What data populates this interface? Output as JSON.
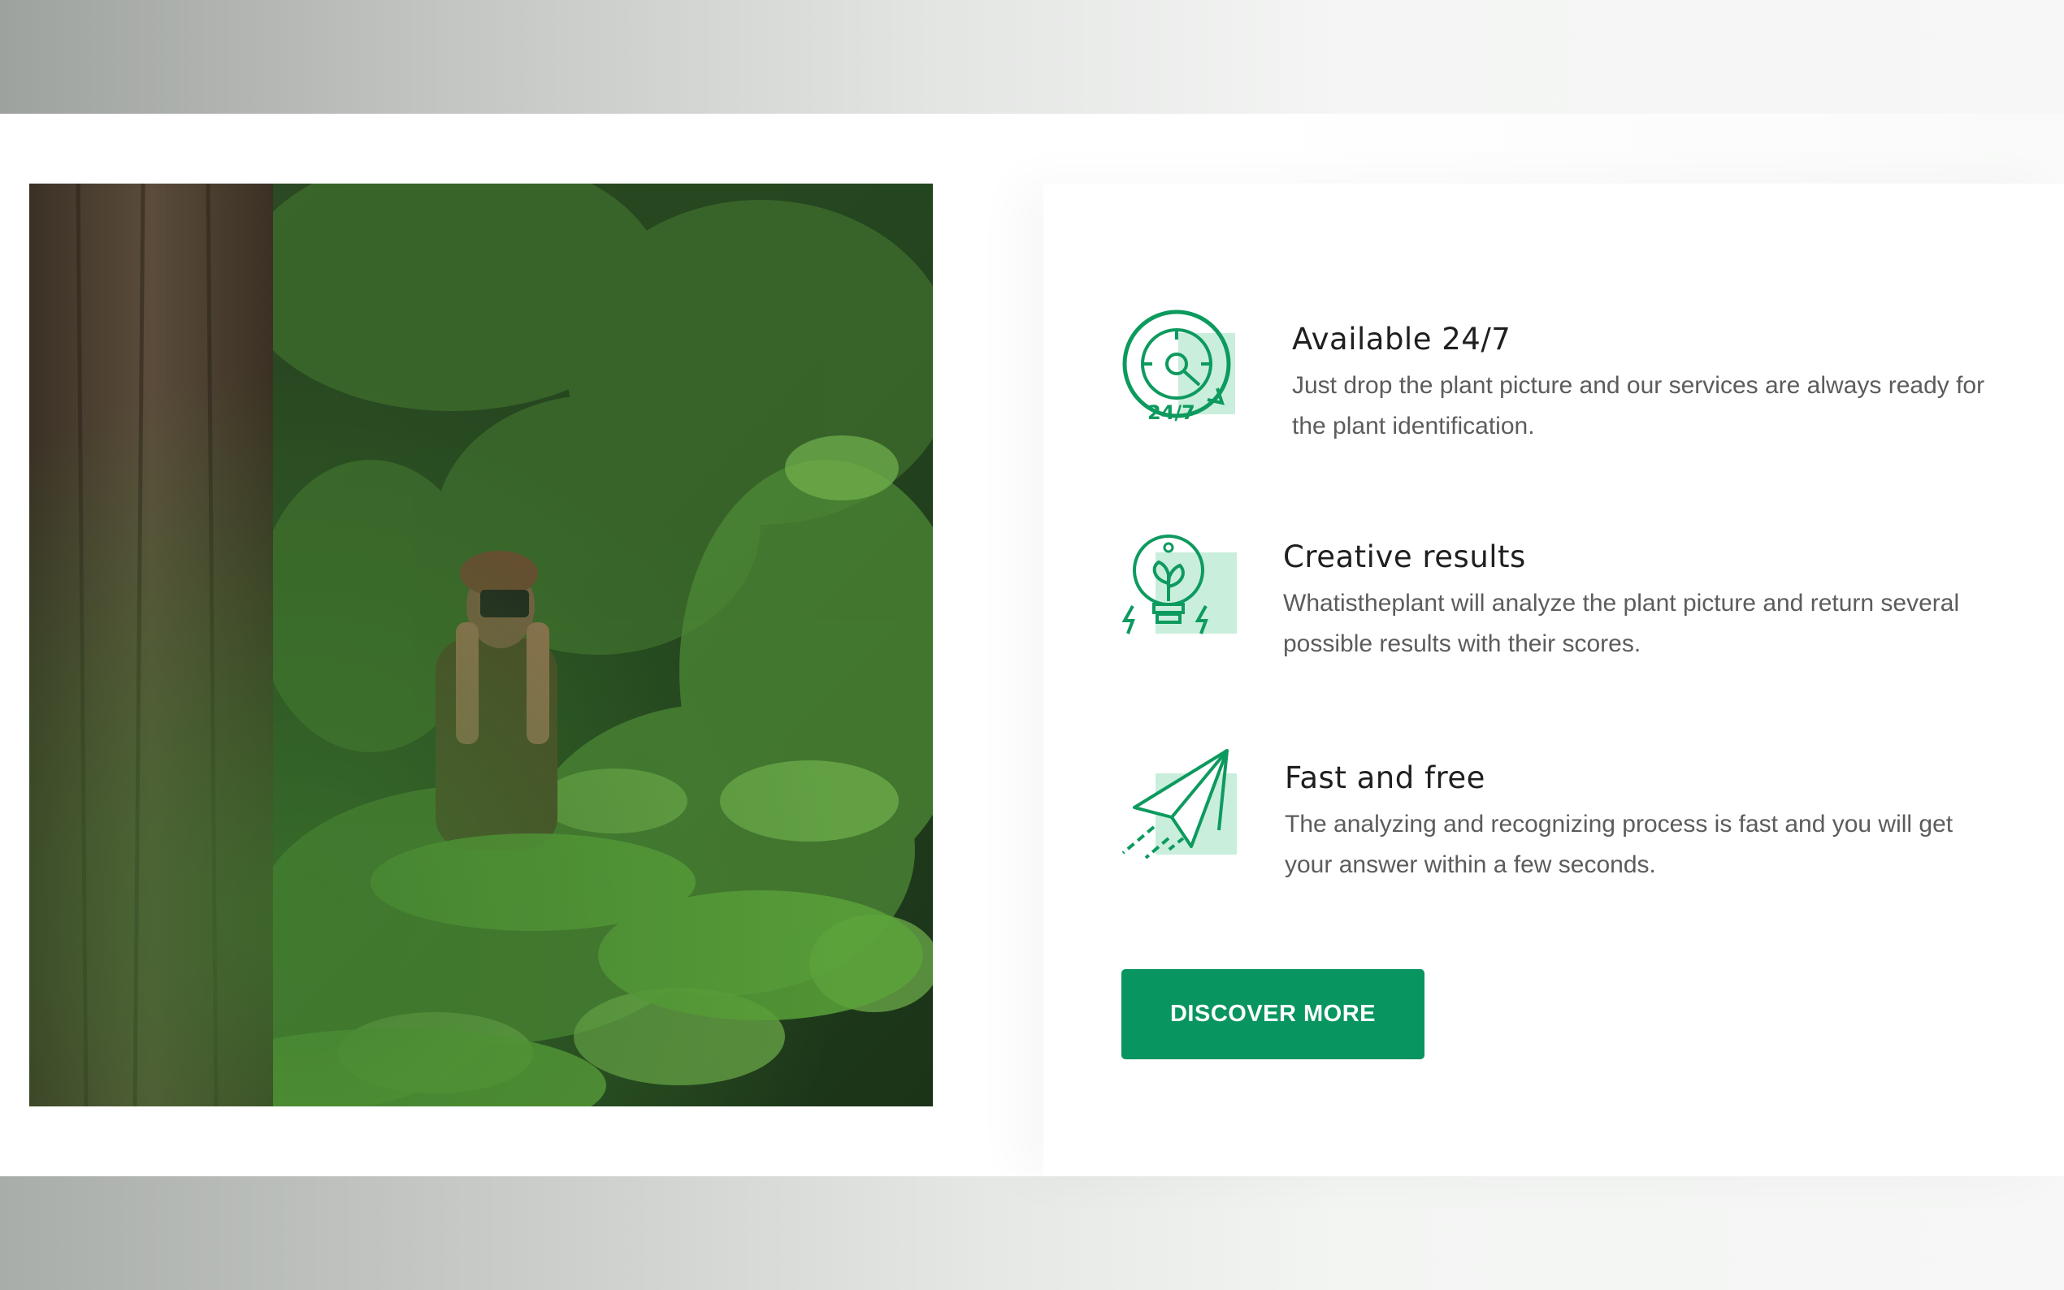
{
  "features": [
    {
      "title": "Available 24/7",
      "description": "Just drop the plant picture and our services are always ready for the plant identification.",
      "icon": "clock-24-7-icon",
      "icon_text": "24/7"
    },
    {
      "title": "Creative results",
      "description": "Whatistheplant will analyze the plant picture and return several possible results with their scores.",
      "icon": "lightbulb-plant-icon"
    },
    {
      "title": "Fast and free",
      "description": "The analyzing and recognizing process is fast and you will get your answer within a few seconds.",
      "icon": "paper-plane-icon"
    }
  ],
  "cta": {
    "label": "DISCOVER MORE"
  },
  "colors": {
    "accent": "#08955f",
    "icon_stroke": "#0d9a5e",
    "icon_fill": "#c9eedc",
    "heading": "#1f1f1f",
    "body_text": "#5c5c5c"
  },
  "image": {
    "subject": "forest-photographer-photo"
  }
}
